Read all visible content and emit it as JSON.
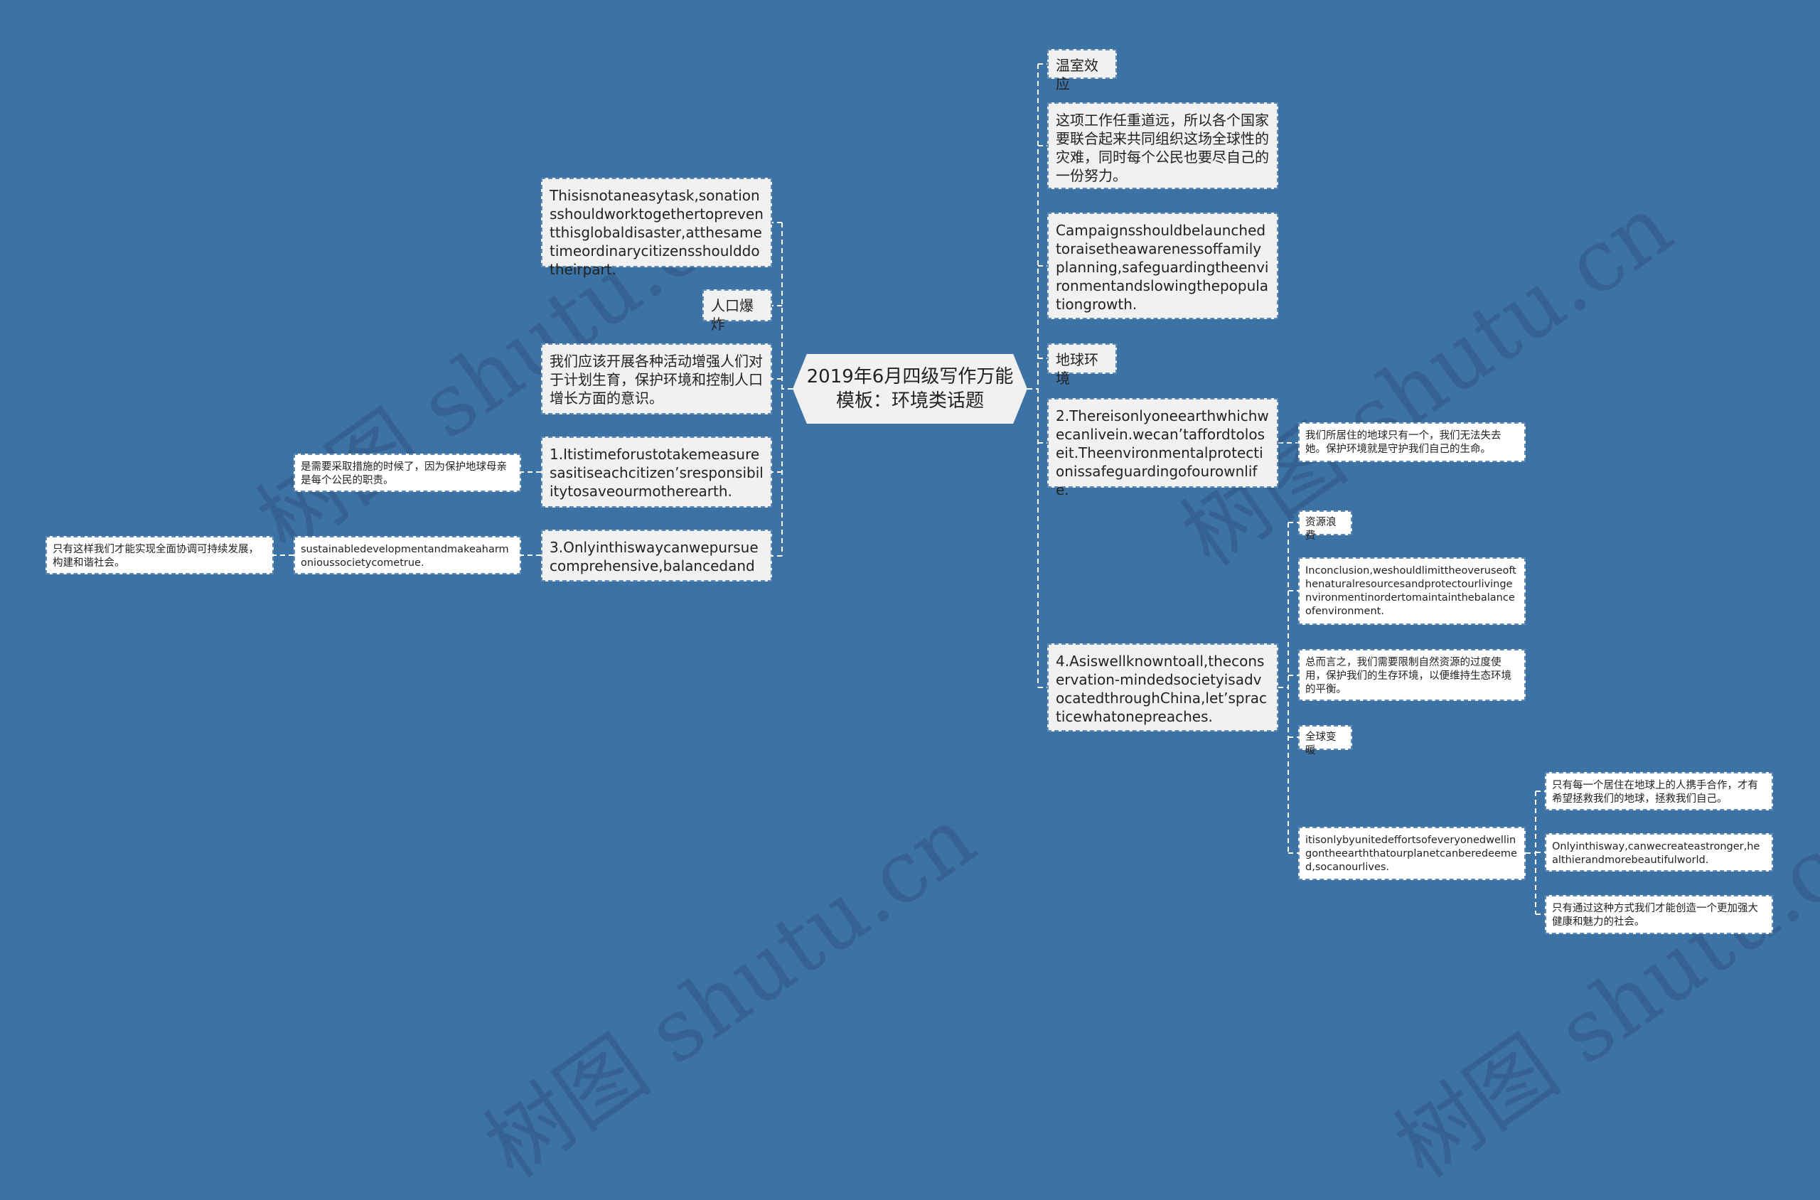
{
  "root": {
    "title_line1": "2019年6月四级写作万能",
    "title_line2": "模板：环境类话题"
  },
  "left": {
    "nodes": [
      {
        "text": "Thisisnotaneasytask,sonationsshouldworktogethertopreventthisglobaldisaster,atthesametimeordinarycitizensshoulddotheirpart."
      },
      {
        "text": "人口爆炸"
      },
      {
        "text": "我们应该开展各种活动增强人们对于计划生育，保护环境和控制人口增长方面的意识。"
      },
      {
        "text": "1.Itistimeforustotakemeasuresasitiseachcitizen’sresponsibilitytosaveourmotherearth.",
        "children": [
          {
            "text": "是需要采取措施的时候了，因为保护地球母亲是每个公民的职责。"
          }
        ]
      },
      {
        "text": "3.Onlyinthiswaycanwepursuecomprehensive,balancedand",
        "children": [
          {
            "text": "sustainabledevelopmentandmakeaharmonioussocietycometrue.",
            "children": [
              {
                "text": "只有这样我们才能实现全面协调可持续发展，构建和谐社会。"
              }
            ]
          }
        ]
      }
    ]
  },
  "right": {
    "nodes": [
      {
        "text": "温室效应"
      },
      {
        "text": "这项工作任重道远，所以各个国家要联合起来共同组织这场全球性的灾难，同时每个公民也要尽自己的一份努力。"
      },
      {
        "text": "Campaignsshouldbelaunchedtoraisetheawarenessoffamilyplanning,safeguardingtheenvironmentandslowingthepopulationgrowth."
      },
      {
        "text": "地球环境"
      },
      {
        "text": "2.Thereisonlyoneearthwhichwecanlivein.wecan’taffordtoloseit.Theenvironmentalprotectionissafeguardingofourownlife.",
        "children": [
          {
            "text": "我们所居住的地球只有一个，我们无法失去她。保护环境就是守护我们自己的生命。"
          }
        ]
      },
      {
        "text": "4.Asiswellknowntoall,theconservation-mindedsocietyisadvocatedthroughChina,let’spracticewhatonepreaches.",
        "children": [
          {
            "text": "资源浪费"
          },
          {
            "text": "Inconclusion,weshouldlimittheoveruseofthenaturalresourcesandprotectourlivingenvironmentinordertomaintainthebalanceofenvironment."
          },
          {
            "text": "总而言之，我们需要限制自然资源的过度使用，保护我们的生存环境，以便维持生态环境的平衡。"
          },
          {
            "text": "全球变暖"
          },
          {
            "text": "itisonlybyunitedeffortsofeveryonedwellingontheearththatourplanetcanberedeemed,socanourlives.",
            "children": [
              {
                "text": "只有每一个居住在地球上的人携手合作，才有希望拯救我们的地球，拯救我们自己。"
              },
              {
                "text": "Onlyinthisway,canwecreateastronger,healthierandmorebeautifulworld."
              },
              {
                "text": "只有通过这种方式我们才能创造一个更加强大健康和魅力的社会。"
              }
            ]
          }
        ]
      }
    ]
  },
  "watermark": {
    "text": "树图 shutu.cn"
  },
  "colors": {
    "background": "#3d72a4",
    "node_fill": "#f1f1f1",
    "leaf_fill": "#ffffff",
    "connector": "#ffffff"
  }
}
